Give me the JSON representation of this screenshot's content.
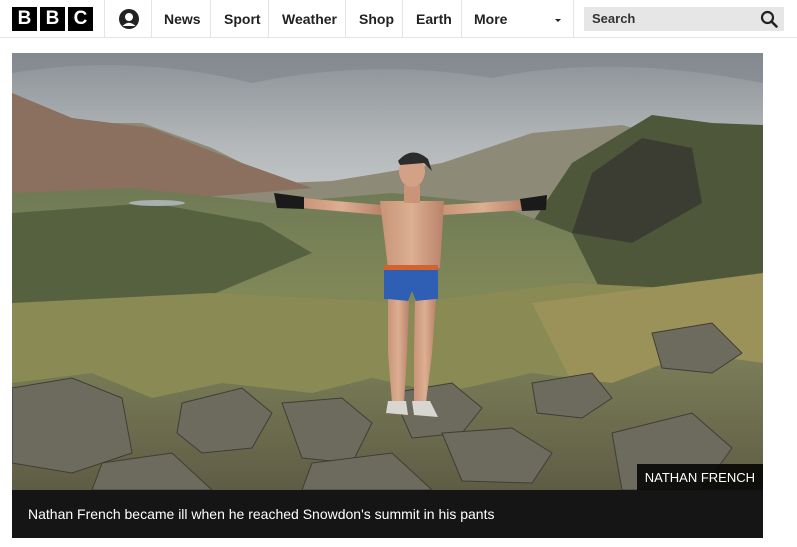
{
  "header": {
    "logo_letters": [
      "B",
      "B",
      "C"
    ],
    "account_icon": "account-icon",
    "nav": [
      {
        "label": "News"
      },
      {
        "label": "Sport"
      },
      {
        "label": "Weather"
      },
      {
        "label": "Shop"
      },
      {
        "label": "Earth"
      },
      {
        "label": "More"
      }
    ],
    "search_placeholder": "Search",
    "search_icon": "magnifier-icon"
  },
  "article": {
    "image_credit": "NATHAN FRENCH",
    "caption": "Nathan French became ill when he reached Snowdon's summit in his pants"
  }
}
